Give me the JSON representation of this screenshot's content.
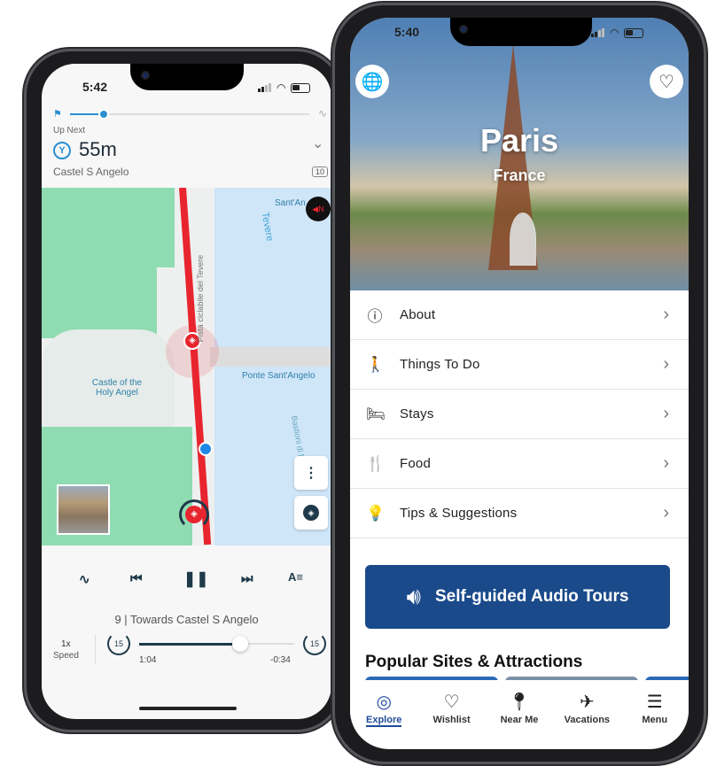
{
  "left_phone": {
    "status_time": "5:42",
    "up_next_label": "Up Next",
    "distance": "55m",
    "next_stop": "Castel S Angelo",
    "stop_badge": "10",
    "progress": 0.14,
    "map": {
      "labels": {
        "sant_angelo": "Sant'An",
        "tevere": "Tevere",
        "pista": "Pista ciclabile del Tevere",
        "castle": "Castle of the Holy Angel",
        "ponte": "Ponte Sant'Angelo",
        "bastioni": "Bastioni di Ro"
      }
    },
    "player": {
      "track": "9 | Towards Castel S Angelo",
      "speed_value": "1x",
      "speed_label": "Speed",
      "elapsed": "1:04",
      "remaining": "-0:34",
      "skip_back": "15",
      "skip_fwd": "15",
      "position": 0.65
    }
  },
  "right_phone": {
    "status_time": "5:40",
    "city": "Paris",
    "country": "France",
    "menu": [
      {
        "icon": "info-icon",
        "label": "About"
      },
      {
        "icon": "walking-icon",
        "label": "Things To Do"
      },
      {
        "icon": "bed-icon",
        "label": "Stays"
      },
      {
        "icon": "utensils-icon",
        "label": "Food"
      },
      {
        "icon": "lightbulb-icon",
        "label": "Tips & Suggestions"
      }
    ],
    "audio_button": "Self-guided Audio Tours",
    "section_title": "Popular Sites & Attractions",
    "nav": [
      {
        "label": "Explore",
        "active": true
      },
      {
        "label": "Wishlist"
      },
      {
        "label": "Near Me"
      },
      {
        "label": "Vacations"
      },
      {
        "label": "Menu"
      }
    ],
    "colors": {
      "accent": "#1a4a8a",
      "route": "#e8252e",
      "nav_active": "#1f4a9c"
    }
  }
}
